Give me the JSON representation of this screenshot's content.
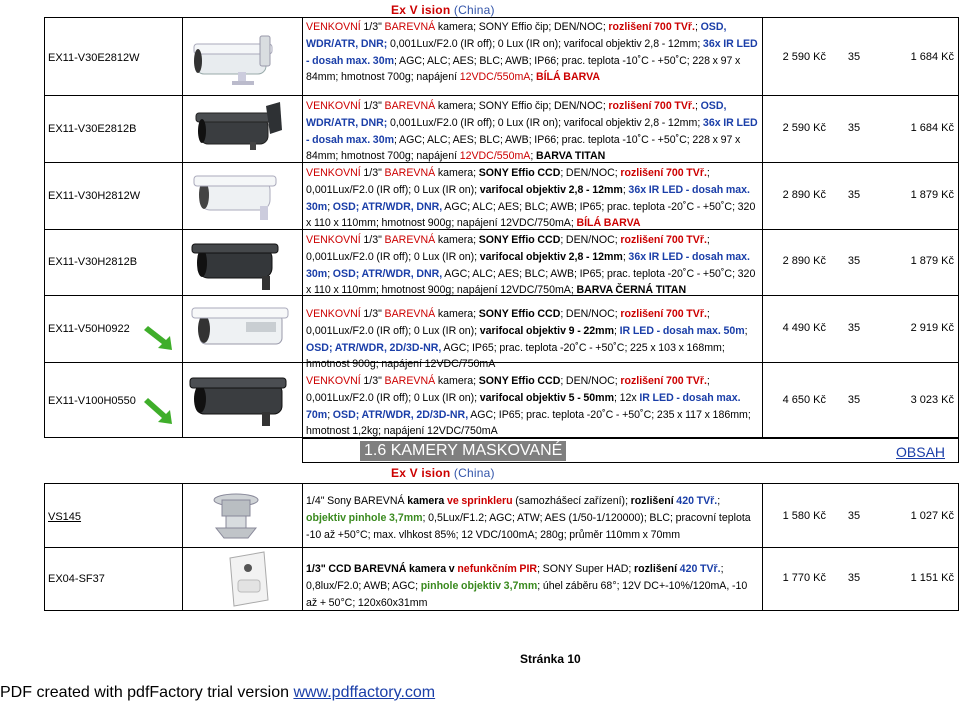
{
  "header_brand": {
    "brand": "Ex V ision",
    "country": "(China)"
  },
  "rows_top": [
    {
      "code": "EX11-V30E2812W",
      "price": "2 590 Kč",
      "qty": "35",
      "price2": "1 684 Kč"
    },
    {
      "code": "EX11-V30E2812B",
      "price": "2 590 Kč",
      "qty": "35",
      "price2": "1 684 Kč"
    },
    {
      "code": "EX11-V30H2812W",
      "price": "2 890 Kč",
      "qty": "35",
      "price2": "1 879 Kč"
    },
    {
      "code": "EX11-V30H2812B",
      "price": "2 890 Kč",
      "qty": "35",
      "price2": "1 879 Kč"
    },
    {
      "code": "EX11-V50H0922",
      "price": "4 490 Kč",
      "qty": "35",
      "price2": "2 919 Kč"
    },
    {
      "code": "EX11-V100H0550",
      "price": "4 650 Kč",
      "qty": "35",
      "price2": "3 023 Kč"
    }
  ],
  "section": {
    "title": "1.6  KAMERY MASKOVANÉ",
    "link": "OBSAH",
    "brand": "Ex V ision",
    "country": "(China)"
  },
  "rows_bottom": [
    {
      "code": "VS145",
      "price": "1 580 Kč",
      "qty": "35",
      "price2": "1 027 Kč"
    },
    {
      "code": "EX04-SF37",
      "price": "1 770 Kč",
      "qty": "35",
      "price2": "1 151 Kč"
    }
  ],
  "page_number": "Stránka 10",
  "footer": {
    "text": "PDF created with pdfFactory trial version ",
    "link": "www.pdffactory.com"
  }
}
